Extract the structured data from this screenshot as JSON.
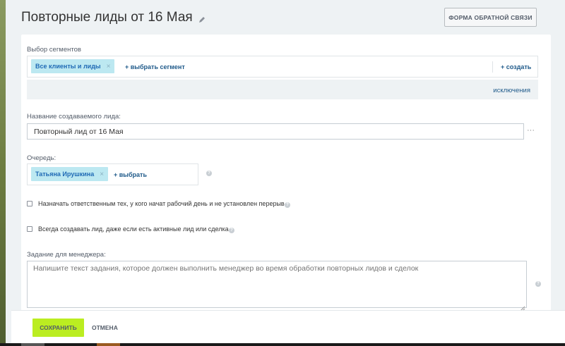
{
  "header": {
    "title": "Повторные лиды от 16 Мая",
    "feedback_button": "ФОРМА ОБРАТНОЙ СВЯЗИ"
  },
  "segments": {
    "label": "Выбор сегментов",
    "tag": "Все клиенты и лиды",
    "tag_remove": "×",
    "select_link": "+ выбрать сегмент",
    "create_link": "+ создать",
    "exclusions_link": "исключения"
  },
  "lead_name": {
    "label": "Название создаваемого лида:",
    "value": "Повторный лид от 16 Мая",
    "more": "···"
  },
  "queue": {
    "label": "Очередь:",
    "tag": "Татьяна Ирушкина",
    "tag_remove": "×",
    "select_link": "+ выбрать",
    "help": "?"
  },
  "options": {
    "assign_label": "Назначать ответственным тех, у кого начат рабочий день и не установлен перерыв.",
    "always_create_label": "Всегда создавать лид, даже если есть активные лид или сделка",
    "help": "?"
  },
  "task": {
    "label": "Задание для менеджера:",
    "placeholder": "Напишите текст задания, которое должен выполнить менеджер во время обработки повторных лидов и сделок",
    "help": "?"
  },
  "footer": {
    "save": "СОХРАНИТЬ",
    "cancel": "ОТМЕНА"
  },
  "colors": {
    "accent_green": "#bbed21",
    "tag_bg": "#bce8f1",
    "link": "#1f5a8a"
  }
}
